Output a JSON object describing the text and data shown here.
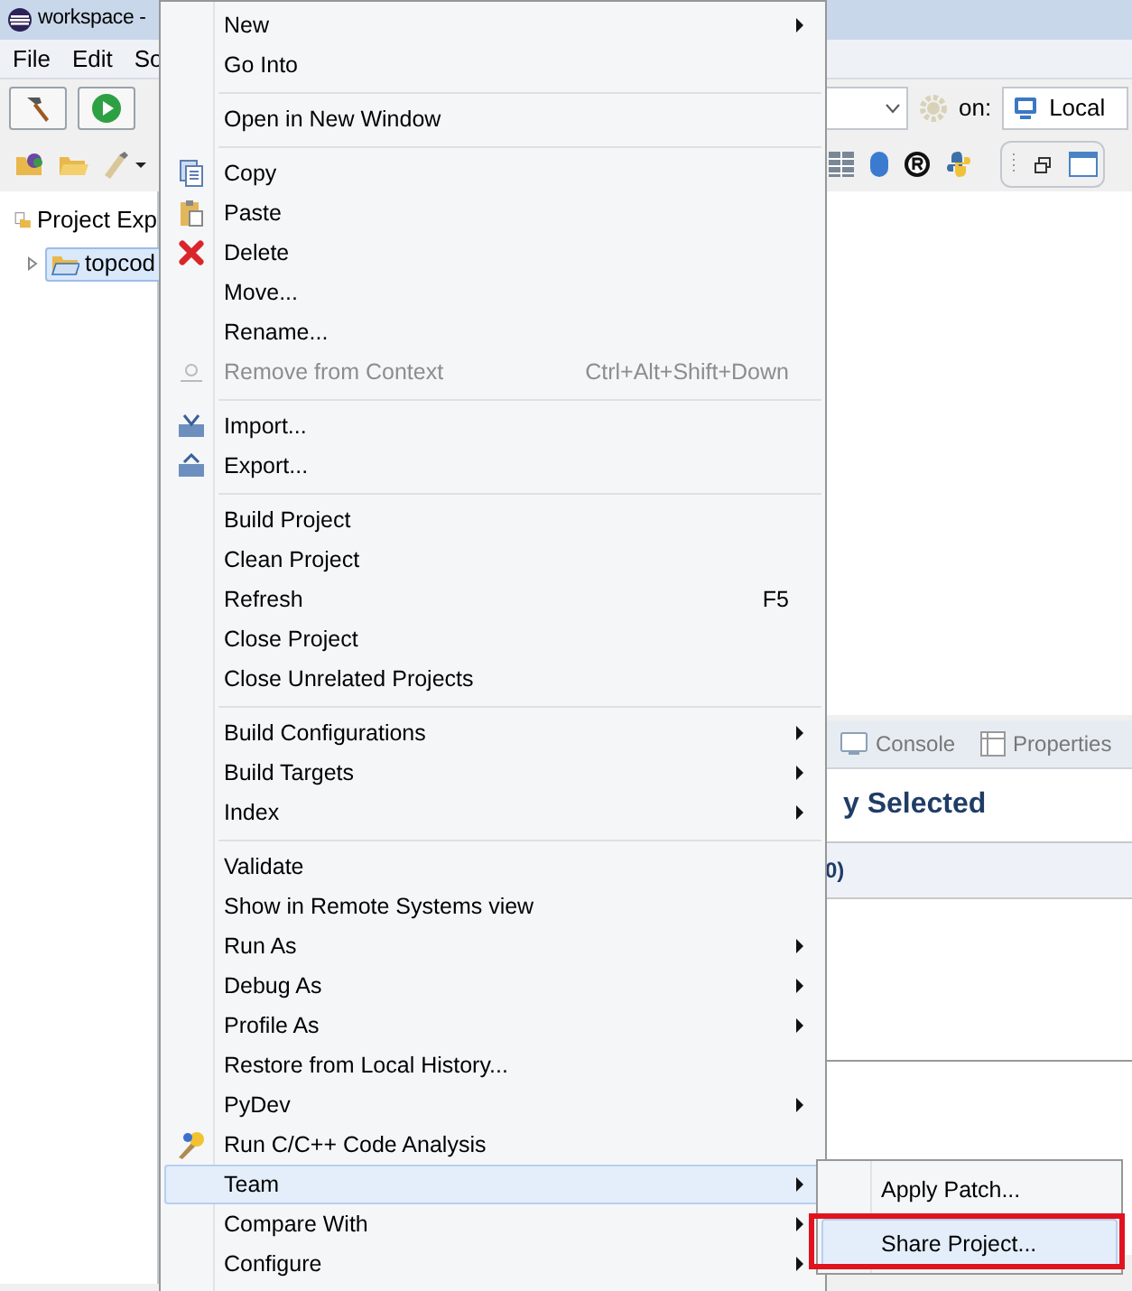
{
  "window": {
    "title": "workspace -"
  },
  "menubar": [
    {
      "label": "File"
    },
    {
      "label": "Edit"
    },
    {
      "label": "So"
    }
  ],
  "launch_bar": {
    "on_label": "on:",
    "target": "Local"
  },
  "project_explorer": {
    "tab": "Project Exp",
    "tree": [
      {
        "label": "topcod",
        "selected": true,
        "expanded": false
      }
    ]
  },
  "bottom_panel": {
    "tabs": [
      {
        "label": "Console",
        "selected": false
      },
      {
        "label": "Properties",
        "selected": false
      }
    ],
    "heading": "y Selected",
    "row": "0)"
  },
  "context_menu": {
    "items": [
      {
        "kind": "item",
        "label": "New",
        "submenu": true,
        "disabled": false,
        "selected": false
      },
      {
        "kind": "item",
        "label": "Go Into",
        "submenu": false,
        "disabled": false,
        "selected": false
      },
      {
        "kind": "separator"
      },
      {
        "kind": "item",
        "label": "Open in New Window",
        "submenu": false,
        "disabled": false,
        "selected": false
      },
      {
        "kind": "separator"
      },
      {
        "kind": "item",
        "label": "Copy",
        "submenu": false,
        "disabled": false,
        "selected": false
      },
      {
        "kind": "item",
        "label": "Paste",
        "submenu": false,
        "disabled": false,
        "selected": false
      },
      {
        "kind": "item",
        "label": "Delete",
        "submenu": false,
        "disabled": false,
        "selected": false
      },
      {
        "kind": "item",
        "label": "Move...",
        "submenu": false,
        "disabled": false,
        "selected": false
      },
      {
        "kind": "item",
        "label": "Rename...",
        "submenu": false,
        "disabled": false,
        "selected": false
      },
      {
        "kind": "item",
        "label": "Remove from Context",
        "shortcut": "Ctrl+Alt+Shift+Down",
        "submenu": false,
        "disabled": true,
        "selected": false
      },
      {
        "kind": "separator"
      },
      {
        "kind": "item",
        "label": "Import...",
        "submenu": false,
        "disabled": false,
        "selected": false
      },
      {
        "kind": "item",
        "label": "Export...",
        "submenu": false,
        "disabled": false,
        "selected": false
      },
      {
        "kind": "separator"
      },
      {
        "kind": "item",
        "label": "Build Project",
        "submenu": false,
        "disabled": false,
        "selected": false
      },
      {
        "kind": "item",
        "label": "Clean Project",
        "submenu": false,
        "disabled": false,
        "selected": false
      },
      {
        "kind": "item",
        "label": "Refresh",
        "shortcut": "F5",
        "submenu": false,
        "disabled": false,
        "selected": false
      },
      {
        "kind": "item",
        "label": "Close Project",
        "submenu": false,
        "disabled": false,
        "selected": false
      },
      {
        "kind": "item",
        "label": "Close Unrelated Projects",
        "submenu": false,
        "disabled": false,
        "selected": false
      },
      {
        "kind": "separator"
      },
      {
        "kind": "item",
        "label": "Build Configurations",
        "submenu": true,
        "disabled": false,
        "selected": false
      },
      {
        "kind": "item",
        "label": "Build Targets",
        "submenu": true,
        "disabled": false,
        "selected": false
      },
      {
        "kind": "item",
        "label": "Index",
        "submenu": true,
        "disabled": false,
        "selected": false
      },
      {
        "kind": "separator"
      },
      {
        "kind": "item",
        "label": "Validate",
        "submenu": false,
        "disabled": false,
        "selected": false
      },
      {
        "kind": "item",
        "label": "Show in Remote Systems view",
        "submenu": false,
        "disabled": false,
        "selected": false
      },
      {
        "kind": "item",
        "label": "Run As",
        "submenu": true,
        "disabled": false,
        "selected": false
      },
      {
        "kind": "item",
        "label": "Debug As",
        "submenu": true,
        "disabled": false,
        "selected": false
      },
      {
        "kind": "item",
        "label": "Profile As",
        "submenu": true,
        "disabled": false,
        "selected": false
      },
      {
        "kind": "item",
        "label": "Restore from Local History...",
        "submenu": false,
        "disabled": false,
        "selected": false
      },
      {
        "kind": "item",
        "label": "PyDev",
        "submenu": true,
        "disabled": false,
        "selected": false
      },
      {
        "kind": "item",
        "label": "Run C/C++ Code Analysis",
        "submenu": false,
        "disabled": false,
        "selected": false
      },
      {
        "kind": "item",
        "label": "Team",
        "submenu": true,
        "disabled": false,
        "selected": true
      },
      {
        "kind": "item",
        "label": "Compare With",
        "submenu": true,
        "disabled": false,
        "selected": false
      },
      {
        "kind": "item",
        "label": "Configure",
        "submenu": true,
        "disabled": false,
        "selected": false
      }
    ]
  },
  "submenu": {
    "items": [
      {
        "label": "Apply Patch...",
        "selected": false,
        "annotated": false
      },
      {
        "label": "Share Project...",
        "selected": true,
        "annotated": true
      }
    ]
  }
}
